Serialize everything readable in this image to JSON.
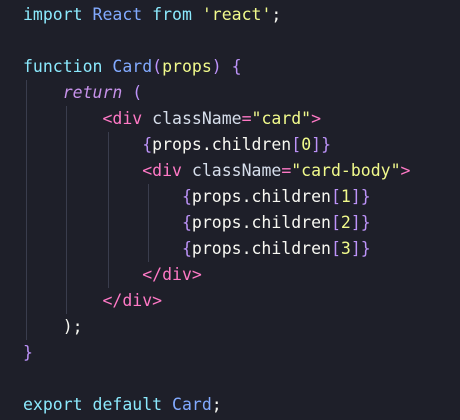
{
  "editor": {
    "lines": [
      [
        {
          "t": "import",
          "c": "kw"
        },
        {
          "t": " ",
          "c": ""
        },
        {
          "t": "React",
          "c": "fn"
        },
        {
          "t": " ",
          "c": ""
        },
        {
          "t": "from",
          "c": "kw"
        },
        {
          "t": " ",
          "c": ""
        },
        {
          "t": "'react'",
          "c": "str"
        },
        {
          "t": ";",
          "c": ""
        }
      ],
      [],
      [
        {
          "t": "function",
          "c": "kw"
        },
        {
          "t": " ",
          "c": ""
        },
        {
          "t": "Card",
          "c": "fn"
        },
        {
          "t": "(",
          "c": "punct"
        },
        {
          "t": "props",
          "c": "str"
        },
        {
          "t": ")",
          "c": "punct"
        },
        {
          "t": " ",
          "c": ""
        },
        {
          "t": "{",
          "c": "punct"
        }
      ],
      [
        {
          "t": "    ",
          "c": ""
        },
        {
          "t": "return",
          "c": "kw-purple ital"
        },
        {
          "t": " ",
          "c": ""
        },
        {
          "t": "(",
          "c": "punct"
        }
      ],
      [
        {
          "t": "        ",
          "c": ""
        },
        {
          "t": "<div",
          "c": "tag"
        },
        {
          "t": " ",
          "c": ""
        },
        {
          "t": "className",
          "c": "attr"
        },
        {
          "t": "=",
          "c": "tag"
        },
        {
          "t": "\"card\"",
          "c": "str"
        },
        {
          "t": ">",
          "c": "tag"
        }
      ],
      [
        {
          "t": "            ",
          "c": ""
        },
        {
          "t": "{",
          "c": "punct"
        },
        {
          "t": "props",
          "c": ""
        },
        {
          "t": ".",
          "c": ""
        },
        {
          "t": "children",
          "c": ""
        },
        {
          "t": "[",
          "c": "punct"
        },
        {
          "t": "0",
          "c": "str"
        },
        {
          "t": "]",
          "c": "punct"
        },
        {
          "t": "}",
          "c": "punct"
        }
      ],
      [
        {
          "t": "            ",
          "c": ""
        },
        {
          "t": "<div",
          "c": "tag"
        },
        {
          "t": " ",
          "c": ""
        },
        {
          "t": "className",
          "c": "attr"
        },
        {
          "t": "=",
          "c": "tag"
        },
        {
          "t": "\"card-body\"",
          "c": "str"
        },
        {
          "t": ">",
          "c": "tag"
        }
      ],
      [
        {
          "t": "                ",
          "c": ""
        },
        {
          "t": "{",
          "c": "punct"
        },
        {
          "t": "props",
          "c": ""
        },
        {
          "t": ".",
          "c": ""
        },
        {
          "t": "children",
          "c": ""
        },
        {
          "t": "[",
          "c": "punct"
        },
        {
          "t": "1",
          "c": "str"
        },
        {
          "t": "]",
          "c": "punct"
        },
        {
          "t": "}",
          "c": "punct"
        }
      ],
      [
        {
          "t": "                ",
          "c": ""
        },
        {
          "t": "{",
          "c": "punct"
        },
        {
          "t": "props",
          "c": ""
        },
        {
          "t": ".",
          "c": ""
        },
        {
          "t": "children",
          "c": ""
        },
        {
          "t": "[",
          "c": "punct"
        },
        {
          "t": "2",
          "c": "str"
        },
        {
          "t": "]",
          "c": "punct"
        },
        {
          "t": "}",
          "c": "punct"
        }
      ],
      [
        {
          "t": "                ",
          "c": ""
        },
        {
          "t": "{",
          "c": "punct"
        },
        {
          "t": "props",
          "c": ""
        },
        {
          "t": ".",
          "c": ""
        },
        {
          "t": "children",
          "c": ""
        },
        {
          "t": "[",
          "c": "punct"
        },
        {
          "t": "3",
          "c": "str"
        },
        {
          "t": "]",
          "c": "punct"
        },
        {
          "t": "}",
          "c": "punct"
        }
      ],
      [
        {
          "t": "            ",
          "c": ""
        },
        {
          "t": "</div>",
          "c": "tag"
        }
      ],
      [
        {
          "t": "        ",
          "c": ""
        },
        {
          "t": "</div>",
          "c": "tag"
        }
      ],
      [
        {
          "t": "    ",
          "c": ""
        },
        {
          "t": ");",
          "c": ""
        }
      ],
      [
        {
          "t": "}",
          "c": "punct"
        }
      ],
      [],
      [
        {
          "t": "export",
          "c": "kw"
        },
        {
          "t": " ",
          "c": ""
        },
        {
          "t": "default",
          "c": "kw"
        },
        {
          "t": " ",
          "c": ""
        },
        {
          "t": "Card",
          "c": "fn"
        },
        {
          "t": ";",
          "c": ""
        }
      ]
    ]
  },
  "colors": {
    "background": "#1e1f29",
    "text": "#f8f8f2",
    "keyword": "#8be9fd",
    "return_keyword": "#c792ea",
    "identifier": "#82aaff",
    "bracket": "#bd93f9",
    "jsx_tag": "#ff79c6",
    "attribute": "#d6deeb",
    "string": "#f1fa8c",
    "indent_guide": "#3a3d4d"
  }
}
